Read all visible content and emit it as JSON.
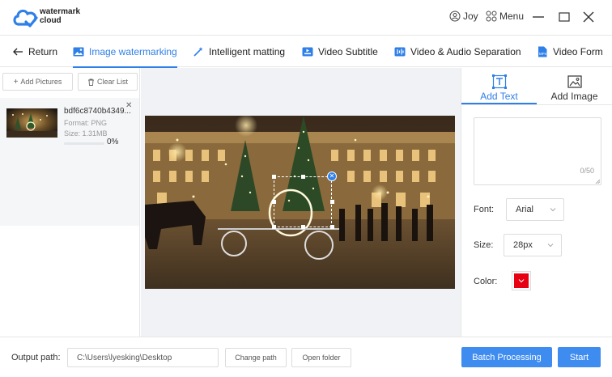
{
  "app": {
    "brand_line1": "watermark",
    "brand_line2": "cloud",
    "user_name": "Joy",
    "menu_label": "Menu",
    "accent": "#2e7fe8"
  },
  "tabs": [
    {
      "label": "Return",
      "icon": "arrow-left-icon"
    },
    {
      "label": "Image watermarking",
      "icon": "image-icon",
      "active": true
    },
    {
      "label": "Intelligent matting",
      "icon": "magic-wand-icon"
    },
    {
      "label": "Video Subtitle",
      "icon": "video-subtitle-icon"
    },
    {
      "label": "Video & Audio Separation",
      "icon": "video-audio-icon"
    },
    {
      "label": "Video Form",
      "icon": "video-format-icon"
    }
  ],
  "left": {
    "add_label": "Add Pictures",
    "clear_label": "Clear List",
    "file": {
      "name": "bdf6c8740b4349...",
      "format": "Format:  PNG",
      "size": "Size:  1.31MB",
      "progress_text": "0%",
      "progress": 0
    }
  },
  "right": {
    "tab_text": "Add Text",
    "tab_image": "Add Image",
    "counter": "0/50",
    "font_label": "Font:",
    "font_value": "Arial",
    "size_label": "Size:",
    "size_value": "28px",
    "color_label": "Color:",
    "color_value": "#e60012"
  },
  "bottom": {
    "output_label": "Output path:",
    "output_path": "C:\\Users\\lyesking\\Desktop",
    "change_label": "Change path",
    "open_label": "Open folder",
    "batch_label": "Batch Processing",
    "start_label": "Start"
  }
}
